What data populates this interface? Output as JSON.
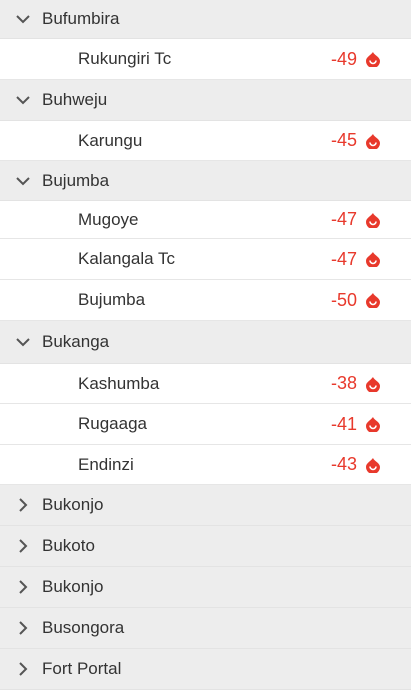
{
  "accent_color": "#e8392c",
  "groups": [
    {
      "title": "Bufumbira",
      "expanded": true,
      "rows": [
        {
          "name": "Rukungiri Tc",
          "value": "-49",
          "icon": "flame-drop-icon"
        }
      ]
    },
    {
      "title": "Buhweju",
      "expanded": true,
      "rows": [
        {
          "name": "Karungu",
          "value": "-45",
          "icon": "flame-drop-icon"
        }
      ]
    },
    {
      "title": "Bujumba",
      "expanded": true,
      "rows": [
        {
          "name": "Mugoye",
          "value": "-47",
          "icon": "flame-drop-icon"
        },
        {
          "name": "Kalangala Tc",
          "value": "-47",
          "icon": "flame-drop-icon"
        },
        {
          "name": "Bujumba",
          "value": "-50",
          "icon": "flame-drop-icon"
        }
      ]
    },
    {
      "title": "Bukanga",
      "expanded": true,
      "rows": [
        {
          "name": "Kashumba",
          "value": "-38",
          "icon": "flame-drop-icon"
        },
        {
          "name": "Rugaaga",
          "value": "-41",
          "icon": "flame-drop-icon"
        },
        {
          "name": "Endinzi",
          "value": "-43",
          "icon": "flame-drop-icon"
        }
      ]
    },
    {
      "title": "Bukonjo",
      "expanded": false,
      "rows": []
    },
    {
      "title": "Bukoto",
      "expanded": false,
      "rows": []
    },
    {
      "title": "Bukonjo",
      "expanded": false,
      "rows": []
    },
    {
      "title": "Busongora",
      "expanded": false,
      "rows": []
    },
    {
      "title": "Fort Portal",
      "expanded": false,
      "rows": []
    }
  ]
}
